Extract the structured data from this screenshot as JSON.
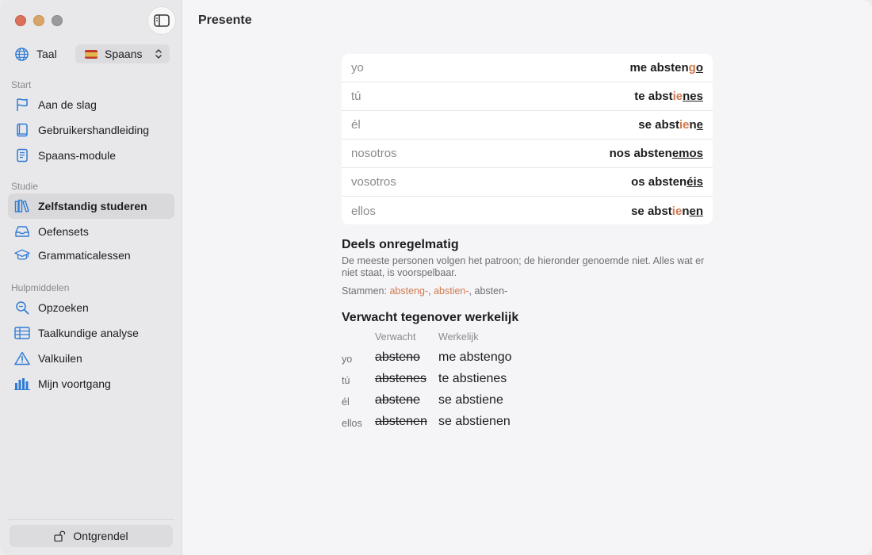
{
  "sidebar": {
    "language_label": "Taal",
    "language_value": "Spaans",
    "sections": {
      "start": "Start",
      "studie": "Studie",
      "hulpmiddelen": "Hulpmiddelen"
    },
    "items": [
      {
        "label": "Aan de slag",
        "icon": "flag-icon"
      },
      {
        "label": "Gebruikershandleiding",
        "icon": "book-icon"
      },
      {
        "label": "Spaans-module",
        "icon": "module-icon"
      },
      {
        "label": "Zelfstandig studeren",
        "icon": "books-icon",
        "active": true
      },
      {
        "label": "Oefensets",
        "icon": "tray-icon"
      },
      {
        "label": "Grammaticalessen",
        "icon": "graduation-cap-icon"
      },
      {
        "label": "Opzoeken",
        "icon": "magnifier-icon"
      },
      {
        "label": "Taalkundige analyse",
        "icon": "table-icon"
      },
      {
        "label": "Valkuilen",
        "icon": "warning-icon"
      },
      {
        "label": "Mijn voortgang",
        "icon": "bar-chart-icon"
      }
    ],
    "unlock_label": "Ontgrendel"
  },
  "main": {
    "title": "Presente",
    "conjugation": [
      {
        "pronoun": "yo",
        "parts": [
          {
            "t": "me absten"
          },
          {
            "t": "g",
            "hl": true,
            "ul": true
          },
          {
            "t": "o",
            "ul": true
          }
        ]
      },
      {
        "pronoun": "tú",
        "parts": [
          {
            "t": "te abst"
          },
          {
            "t": "ie",
            "hl": true
          },
          {
            "t": "nes",
            "ul": true
          }
        ]
      },
      {
        "pronoun": "él",
        "parts": [
          {
            "t": "se abst"
          },
          {
            "t": "ie",
            "hl": true
          },
          {
            "t": "n"
          },
          {
            "t": "e",
            "ul": true
          }
        ]
      },
      {
        "pronoun": "nosotros",
        "parts": [
          {
            "t": "nos absten"
          },
          {
            "t": "emos",
            "ul": true
          }
        ]
      },
      {
        "pronoun": "vosotros",
        "parts": [
          {
            "t": "os absten"
          },
          {
            "t": "éis",
            "ul": true
          }
        ]
      },
      {
        "pronoun": "ellos",
        "parts": [
          {
            "t": "se abst"
          },
          {
            "t": "ie",
            "hl": true
          },
          {
            "t": "n"
          },
          {
            "t": "en",
            "ul": true
          }
        ]
      }
    ],
    "irregular": {
      "title": "Deels onregelmatig",
      "description": "De meeste personen volgen het patroon; de hieronder genoemde niet. Alles wat er niet staat, is voorspelbaar.",
      "stems_label": "Stammen:",
      "stems": [
        "absteng-",
        "abstien-",
        "absten-"
      ]
    },
    "comparison": {
      "title": "Verwacht tegenover werkelijk",
      "col_expected": "Verwacht",
      "col_actual": "Werkelijk",
      "rows": [
        {
          "pronoun": "yo",
          "expected": "absteno",
          "actual": "me abstengo"
        },
        {
          "pronoun": "tú",
          "expected": "abstenes",
          "actual": "te abstienes"
        },
        {
          "pronoun": "él",
          "expected": "abstene",
          "actual": "se abstiene"
        },
        {
          "pronoun": "ellos",
          "expected": "abstenen",
          "actual": "se abstienen"
        }
      ]
    }
  },
  "colors": {
    "accent_blue": "#2f7bd6",
    "highlight_orange": "#d0794e"
  }
}
